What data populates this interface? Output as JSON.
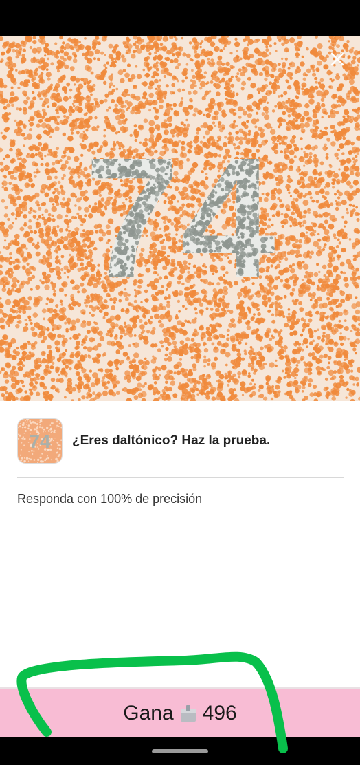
{
  "ad": {
    "plate_number": "74",
    "app_icon_number": "74",
    "title": "¿Eres daltónico? Haz la prueba.",
    "subtitle": "Responda con 100% de precisión",
    "close_icon": "close-icon",
    "cta": {
      "prefix": "Gana",
      "icon": "coin-box-icon",
      "amount": "496"
    }
  },
  "colors": {
    "dot_orange": "#f08a3c",
    "dot_gray": "#8e9690",
    "cta_background": "#f8bcd4",
    "scribble_green": "#09c04b"
  }
}
